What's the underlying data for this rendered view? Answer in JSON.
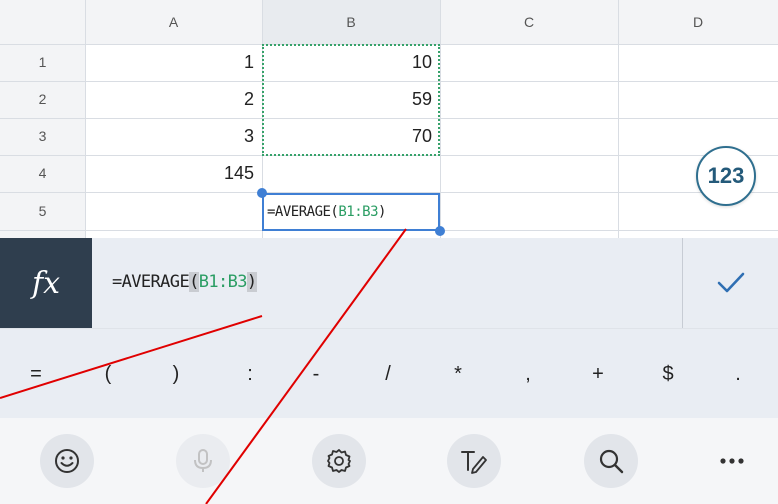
{
  "columns": [
    "A",
    "B",
    "C",
    "D"
  ],
  "rows": [
    {
      "num": "1",
      "a": "1",
      "b": "10"
    },
    {
      "num": "2",
      "a": "2",
      "b": "59"
    },
    {
      "num": "3",
      "a": "3",
      "b": "70"
    },
    {
      "num": "4",
      "a": "145",
      "b": ""
    },
    {
      "num": "5",
      "a": "",
      "b": ""
    }
  ],
  "edit_cell": {
    "prefix": "=AVERAGE(",
    "ref": "B1:B3",
    "suffix": ")"
  },
  "keypad_toggle_label": "123",
  "formula_bar": {
    "fx_label": "fx",
    "prefix": "=AVERAGE",
    "open_paren": "(",
    "ref": "B1:B3",
    "close_paren": ")"
  },
  "symbols": [
    "=",
    "(",
    ")",
    ":",
    "-",
    "/",
    "*",
    ",",
    "+",
    "$",
    "."
  ],
  "toolbar": {
    "icons": [
      "emoji-icon",
      "microphone-icon",
      "settings-icon",
      "handwriting-icon",
      "search-icon",
      "more-icon"
    ]
  },
  "colors": {
    "accent": "#3f7fd4",
    "reference_green": "#2a9d63",
    "fx_background": "#2f3e4e",
    "annotation_red": "#e00000"
  }
}
